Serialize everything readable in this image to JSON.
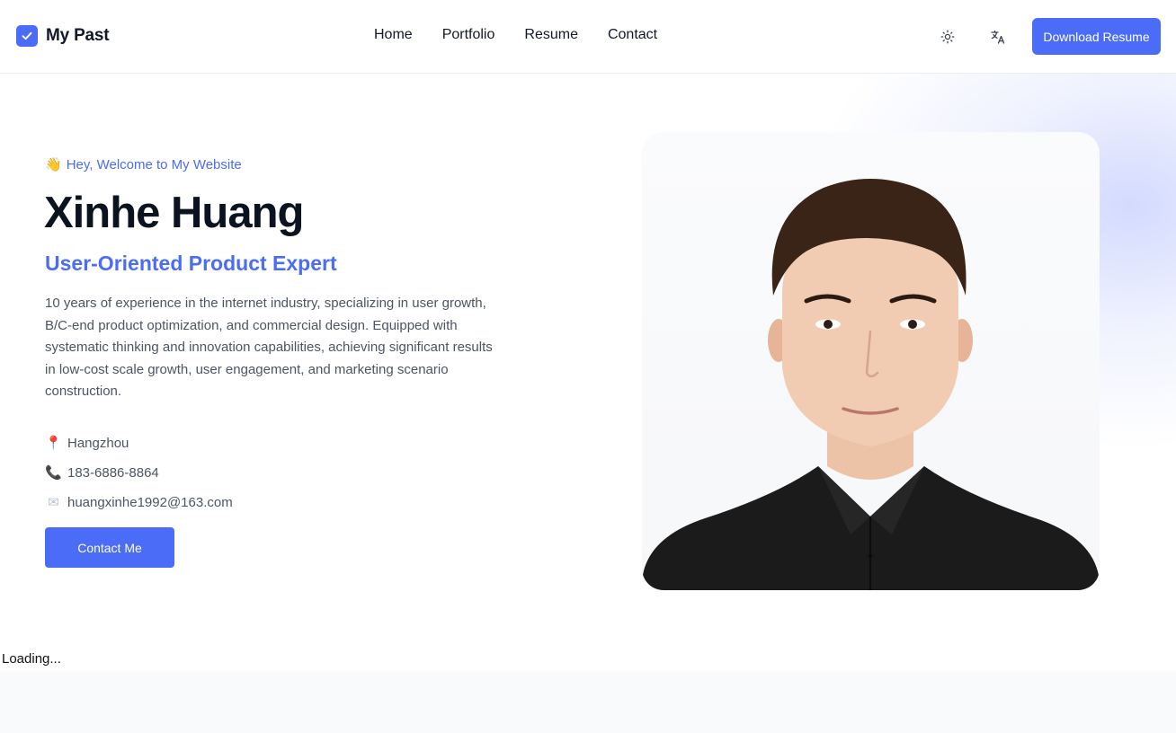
{
  "header": {
    "brand_name": "My Past",
    "brand_icon": "check-icon",
    "nav": {
      "home": "Home",
      "portfolio": "Portfolio",
      "resume": "Resume",
      "contact": "Contact"
    },
    "theme_icon": "sun-icon",
    "language_icon": "translate-icon",
    "download_label": "Download Resume"
  },
  "hero": {
    "greeting_emoji": "👋",
    "greeting": "Hey, Welcome to My Website",
    "name": "Xinhe Huang",
    "role": "User-Oriented Product Expert",
    "description": "10 years of experience in the internet industry, specializing in user growth, B/C-end product optimization, and commercial design. Equipped with systematic thinking and innovation capabilities, achieving significant results in low-cost scale growth, user engagement, and marketing scenario construction.",
    "contacts": {
      "location_icon": "📍",
      "location": "Hangzhou",
      "phone_icon": "📞",
      "phone": "183-6886-8864",
      "email_icon": "✉",
      "email": "huangxinhe1992@163.com"
    },
    "cta_label": "Contact Me",
    "portrait": "profile-photo"
  },
  "status": {
    "loading": "Loading..."
  },
  "colors": {
    "accent": "#4a6cf7",
    "text_dark": "#111827",
    "text_muted": "#4b5563"
  }
}
